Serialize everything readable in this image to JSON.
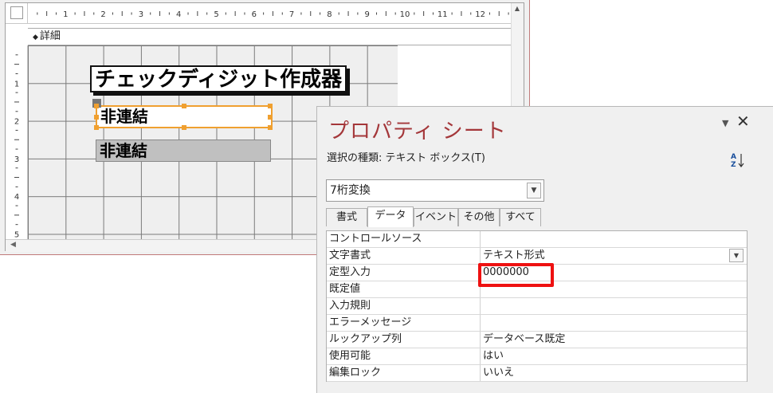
{
  "design": {
    "section_label": "詳細",
    "ruler_h": [
      "1",
      "2",
      "3",
      "4",
      "5",
      "6",
      "7",
      "8",
      "9",
      "10",
      "11",
      "12"
    ],
    "ruler_v": [
      "1",
      "2",
      "3",
      "4",
      "5"
    ],
    "title_label": "チェックディジット作成器",
    "unbound_1": "非連結",
    "unbound_2": "非連結"
  },
  "properties": {
    "title": "プロパティ シート",
    "selection_type": "選択の種類: テキスト ボックス(T)",
    "object_name": "7桁変換",
    "tabs": [
      "書式",
      "データ",
      "イベント",
      "その他",
      "すべて"
    ],
    "active_tab": "データ",
    "rows": [
      {
        "name": "コントロールソース",
        "value": ""
      },
      {
        "name": "文字書式",
        "value": "テキスト形式"
      },
      {
        "name": "定型入力",
        "value": "0000000"
      },
      {
        "name": "既定値",
        "value": ""
      },
      {
        "name": "入力規則",
        "value": ""
      },
      {
        "name": "エラーメッセージ",
        "value": ""
      },
      {
        "name": "ルックアップ列",
        "value": "データベース既定"
      },
      {
        "name": "使用可能",
        "value": "はい"
      },
      {
        "name": "編集ロック",
        "value": "いいえ"
      }
    ]
  },
  "colors": {
    "title": "#a4373a",
    "selection": "#f0a030",
    "highlight": "#ee1111"
  }
}
